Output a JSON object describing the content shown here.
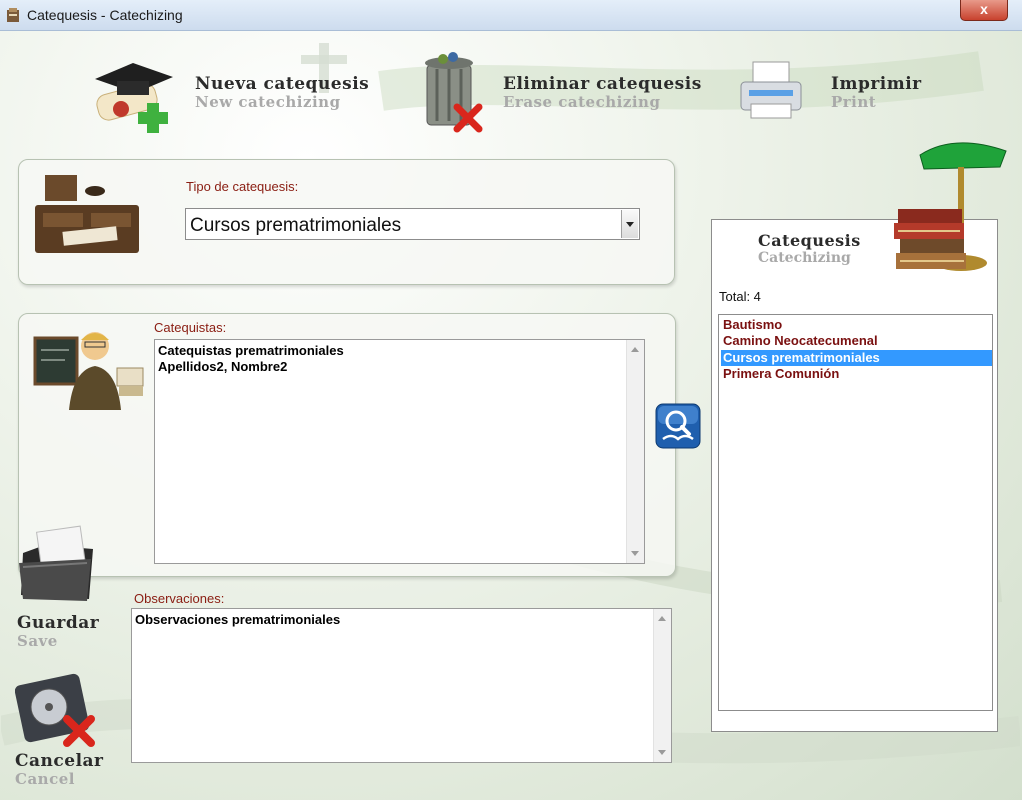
{
  "window": {
    "title": "Catequesis - Catechizing",
    "close_label": "x"
  },
  "toolbar": {
    "new": {
      "title": "Nueva catequesis",
      "subtitle": "New catechizing",
      "icon": "graduation-cap-diploma-add-icon"
    },
    "erase": {
      "title": "Eliminar catequesis",
      "subtitle": "Erase catechizing",
      "icon": "trash-can-delete-icon"
    },
    "print": {
      "title": "Imprimir",
      "subtitle": "Print",
      "icon": "printer-icon"
    }
  },
  "type_panel": {
    "label": "Tipo de catequesis:",
    "selected_value": "Cursos prematrimoniales",
    "icon": "desk-icon"
  },
  "catechists": {
    "label": "Catequistas:",
    "lines": [
      "Catequistas prematrimoniales",
      "Apellidos2, Nombre2"
    ],
    "icon": "teacher-blackboard-icon",
    "search_icon": "search-book-icon"
  },
  "observations": {
    "label": "Observaciones:",
    "lines": [
      "Observaciones prematrimoniales"
    ]
  },
  "side_actions": {
    "save": {
      "title": "Guardar",
      "subtitle": "Save",
      "icon": "folder-save-icon"
    },
    "cancel": {
      "title": "Cancelar",
      "subtitle": "Cancel",
      "icon": "harddisk-cancel-icon"
    }
  },
  "list_panel": {
    "title": "Catequesis",
    "subtitle": "Catechizing",
    "total_text": "Total: 4",
    "items": [
      "Bautismo",
      "Camino Neocatecumenal",
      "Cursos prematrimoniales",
      "Primera Comunión"
    ],
    "selected_index": 2,
    "icon": "banker-lamp-books-icon"
  },
  "colors": {
    "label_red": "#8a1d12",
    "list_item": "#7a1010",
    "selection": "#3399ff"
  }
}
